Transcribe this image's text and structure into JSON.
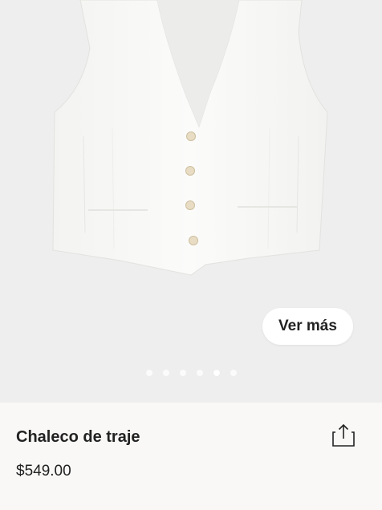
{
  "gallery": {
    "see_more_label": "Ver más",
    "image_count": 6,
    "active_image_index": 4
  },
  "product": {
    "name": "Chaleco de traje",
    "price": "$549.00"
  },
  "icons": {
    "share": "share-icon"
  }
}
